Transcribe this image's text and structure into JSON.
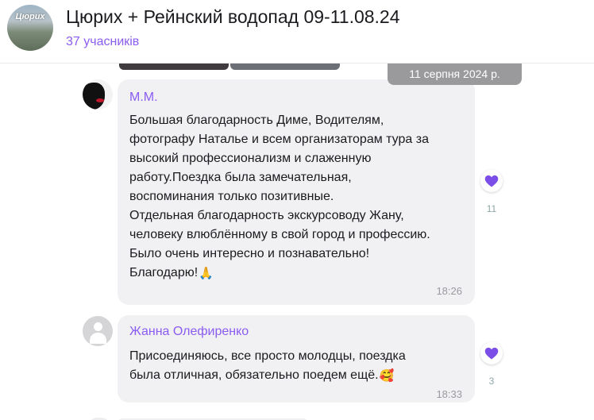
{
  "header": {
    "title": "Цюрих + Рейнский водопад 09-11.08.24",
    "members": "37 учасників",
    "avatar_text": "Цюрих"
  },
  "chat": {
    "date_separator": "11 серпня 2024 р.",
    "messages": [
      {
        "sender": "М.М.",
        "lines": [
          "Большая благодарность Диме, Водителям,",
          "фотографу Натальe и всем организаторам тура за",
          "высокий профессионализм и слаженную",
          "работу.Поездка была замечательная,",
          "воспоминания только позитивные.",
          "Отдельная благодарность экскурсоводу Жану,",
          "человеку влюблённому в свой город и профессию.",
          "Было очень интересно и познавательно!",
          "Благодарю!"
        ],
        "emoji": "🙏",
        "time": "18:26",
        "reaction": {
          "icon": "heart-icon",
          "count": "11"
        }
      },
      {
        "sender": "Жанна Олефиренко",
        "lines": [
          "Присоединяюсь, все просто молодцы, поездка",
          "была отличная, обязательно поедем ещё."
        ],
        "emoji": "🥰",
        "time": "18:33",
        "reaction": {
          "icon": "heart-icon",
          "count": "3"
        }
      }
    ]
  },
  "colors": {
    "accent": "#8a5cf0",
    "heart": "#7b4ee8",
    "bubble": "#f1f1f4",
    "date_pill": "#9a9a9d"
  }
}
